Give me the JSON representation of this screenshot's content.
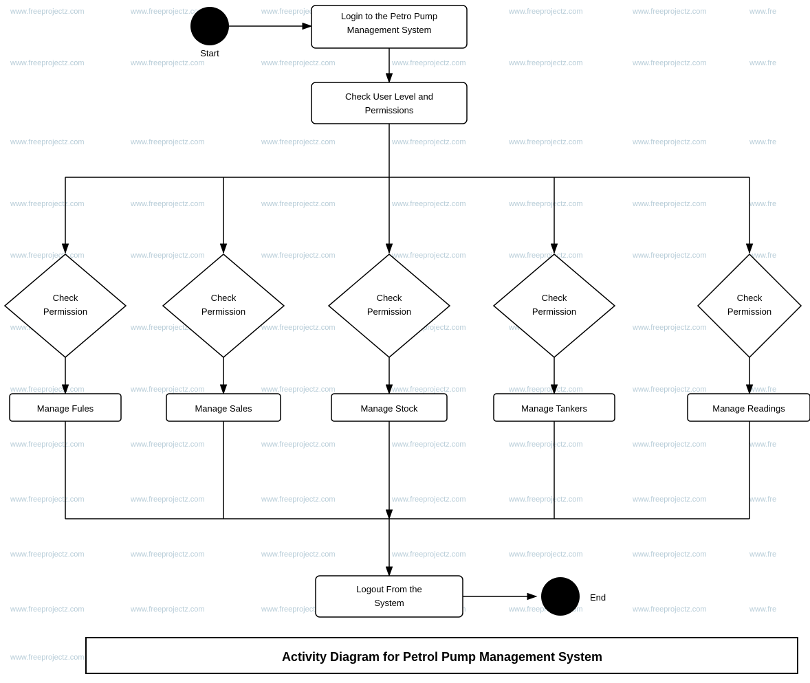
{
  "title": "Activity Diagram for Petrol Pump Management System",
  "watermark": "www.freeprojectz.com",
  "nodes": {
    "start_label": "Start",
    "end_label": "End",
    "login": "Login to the Petro Pump Management System",
    "check_user": "Check User Level and Permissions",
    "check_permission_1": "Check Permission",
    "check_permission_2": "Check Permission",
    "check_permission_3": "Check Permission",
    "check_permission_4": "Check Permission",
    "check_permission_5": "Check Permission",
    "manage_fules": "Manage Fules",
    "manage_sales": "Manage Sales",
    "manage_stock": "Manage Stock",
    "manage_tankers": "Manage Tankers",
    "manage_readings": "Manage Readings",
    "logout": "Logout From the System"
  }
}
